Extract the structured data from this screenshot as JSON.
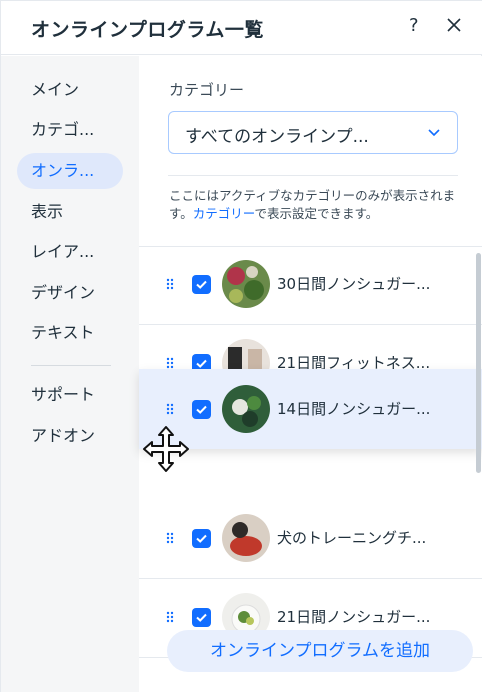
{
  "header": {
    "title": "オンラインプログラム一覧",
    "help_label": "?",
    "close_label": "✕"
  },
  "sidebar": {
    "items": [
      {
        "label": "メイン",
        "active": false
      },
      {
        "label": "カテゴ...",
        "active": false
      },
      {
        "label": "オンラ...",
        "active": true
      },
      {
        "label": "表示",
        "active": false
      },
      {
        "label": "レイア...",
        "active": false
      },
      {
        "label": "デザイン",
        "active": false
      },
      {
        "label": "テキスト",
        "active": false
      },
      {
        "label": "サポート",
        "active": false
      },
      {
        "label": "アドオン",
        "active": false
      }
    ]
  },
  "content": {
    "category_label": "カテゴリー",
    "category_value": "すべてのオンラインプ...",
    "info_text_1": "ここにはアクティブなカテゴリーのみが表示されます。",
    "info_link": "カテゴリー",
    "info_text_2": "で表示設定できます。",
    "programs": [
      {
        "name": "30日間ノンシュガー...",
        "checked": true,
        "icon": "vegetables-photo"
      },
      {
        "name": "21日間フィットネス...",
        "checked": true,
        "icon": "fitness-photo"
      },
      {
        "name": "14日間ノンシュガー...",
        "checked": true,
        "icon": "greens-photo",
        "dragging": true
      },
      {
        "name": "犬のトレーニングチ...",
        "checked": true,
        "icon": "dog-photo"
      },
      {
        "name": "21日間ノンシュガー...",
        "checked": true,
        "icon": "salad-photo"
      }
    ],
    "add_button": "オンラインプログラムを追加"
  },
  "colors": {
    "accent": "#116dff",
    "active_bg": "#dfe8fb",
    "sidebar_bg": "#f5f6f7"
  }
}
